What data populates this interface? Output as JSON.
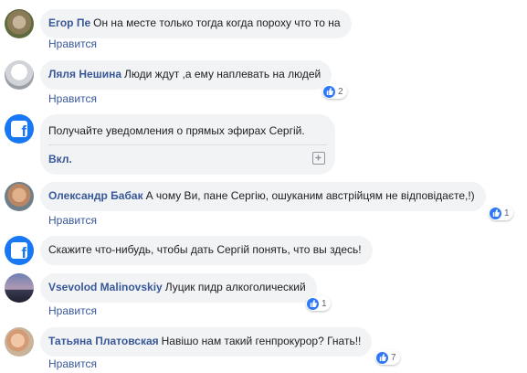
{
  "like_label": "Нравится",
  "colors": {
    "link": "#385898",
    "bubble": "#f2f3f5",
    "like_blue": "#2e78f7",
    "facebook": "#1877f2"
  },
  "comments": [
    {
      "author": "Егор Пе",
      "text": "Он на месте только тогда когда пороху что то на",
      "likes": null
    },
    {
      "author": "Ляля Нешина",
      "text": "Люди ждут ,а ему наплевать на людей",
      "likes": "2"
    },
    {
      "author": "Олександр Бабак",
      "text": "А чому Ви, пане Сергію, ошуканим австрійцям не відповідаєте,!)",
      "likes": "1"
    },
    {
      "author": "Vsevolod Malinovskiy",
      "text": "Луцик пидр алкоголический",
      "likes": "1"
    },
    {
      "author": "Татьяна Платовская",
      "text": "Навішо нам такий генпрокурор? Гнать!!",
      "likes": "7"
    }
  ],
  "subscribe": {
    "text": "Получайте уведомления о прямых эфирах Сергій.",
    "button": "Вкл.",
    "icon": "add-notification-icon"
  },
  "prompt": {
    "text": "Скажите что-нибудь, чтобы дать Сергій понять, что вы здесь!",
    "icon": "facebook-icon"
  }
}
